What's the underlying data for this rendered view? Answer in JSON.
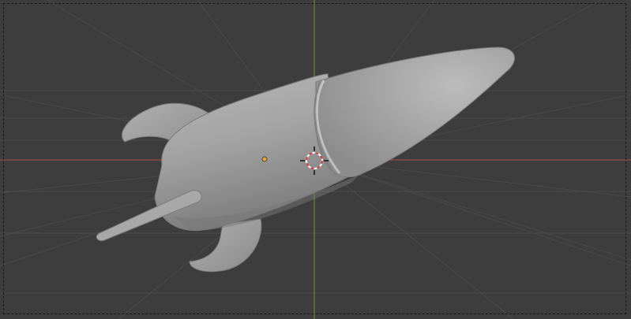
{
  "viewport": {
    "background": "#3d3d3d",
    "grid_color": "#4a4a4a",
    "x_axis_color": "#b04a4a",
    "y_axis_color": "#6a9a2a",
    "object_color": "#a7a7a7",
    "origin_color": "#f0a030",
    "cursor_colors": [
      "#d33a3a",
      "#ffffff"
    ]
  },
  "scene": {
    "object": "rocket-mesh",
    "cursor": "3d-cursor-icon",
    "origin": "object-origin-icon"
  }
}
